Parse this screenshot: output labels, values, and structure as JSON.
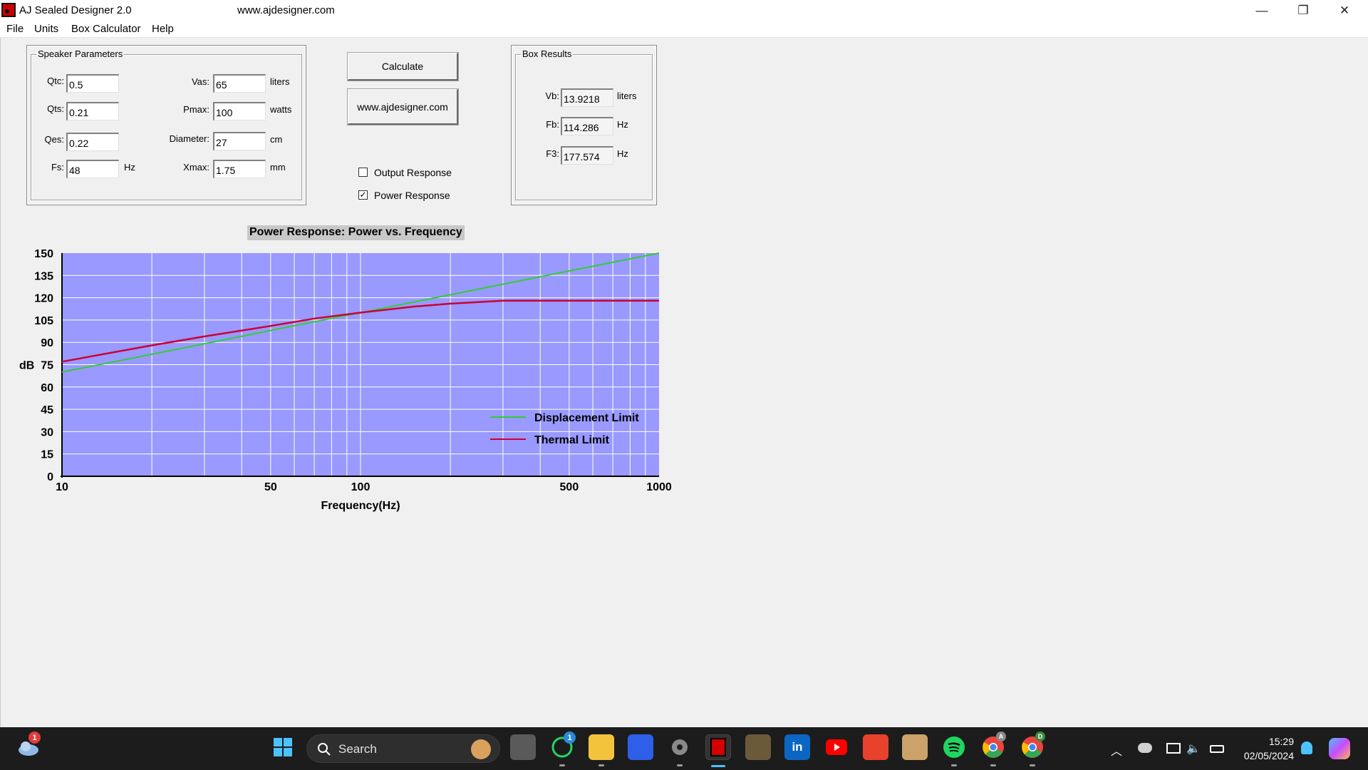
{
  "window": {
    "title": "AJ Sealed Designer 2.0",
    "url": "www.ajdesigner.com",
    "minimize_glyph": "—",
    "restore_glyph": "❐",
    "close_glyph": "✕"
  },
  "menu": [
    "File",
    "Units",
    "Box Calculator",
    "Help"
  ],
  "speaker_params": {
    "legend": "Speaker Parameters",
    "qtc": {
      "label": "Qtc:",
      "value": "0.5"
    },
    "qts": {
      "label": "Qts:",
      "value": "0.21"
    },
    "qes": {
      "label": "Qes:",
      "value": "0.22"
    },
    "fs": {
      "label": "Fs:",
      "value": "48",
      "unit": "Hz"
    },
    "vas": {
      "label": "Vas:",
      "value": "65",
      "unit": "liters"
    },
    "pmax": {
      "label": "Pmax:",
      "value": "100",
      "unit": "watts"
    },
    "diameter": {
      "label": "Diameter:",
      "value": "27",
      "unit": "cm"
    },
    "xmax": {
      "label": "Xmax:",
      "value": "1.75",
      "unit": "mm"
    }
  },
  "buttons": {
    "calculate": "Calculate",
    "website": "www.ajdesigner.com"
  },
  "options": {
    "output_response": {
      "label": "Output Response",
      "checked": false
    },
    "power_response": {
      "label": "Power Response",
      "checked": true
    },
    "check_glyph": "✓"
  },
  "box_results": {
    "legend": "Box Results",
    "vb": {
      "label": "Vb:",
      "value": "13.9218",
      "unit": "liters"
    },
    "fb": {
      "label": "Fb:",
      "value": "114.286",
      "unit": "Hz"
    },
    "f3": {
      "label": "F3:",
      "value": "177.574",
      "unit": "Hz"
    }
  },
  "chart_data": {
    "type": "line",
    "title": "Power Response: Power vs. Frequency",
    "xlabel": "Frequency(Hz)",
    "ylabel": "dB",
    "x_scale": "log",
    "xlim": [
      10,
      1000
    ],
    "ylim": [
      0,
      150
    ],
    "x_ticks": [
      10,
      50,
      100,
      500,
      1000
    ],
    "y_ticks": [
      0,
      15,
      30,
      45,
      60,
      75,
      90,
      105,
      120,
      135,
      150
    ],
    "grid": true,
    "plot_background": "#9999ff",
    "legend_position": "bottom-right",
    "series": [
      {
        "name": "Displacement Limit",
        "color": "#33cc33",
        "points": [
          [
            10,
            70
          ],
          [
            20,
            82
          ],
          [
            50,
            98
          ],
          [
            100,
            110
          ],
          [
            200,
            122
          ],
          [
            500,
            138
          ],
          [
            1000,
            150
          ]
        ]
      },
      {
        "name": "Thermal Limit",
        "color": "#cc0033",
        "points": [
          [
            10,
            77
          ],
          [
            20,
            88
          ],
          [
            30,
            94
          ],
          [
            50,
            101
          ],
          [
            70,
            106
          ],
          [
            100,
            110
          ],
          [
            150,
            114
          ],
          [
            200,
            116
          ],
          [
            300,
            118
          ],
          [
            500,
            118
          ],
          [
            1000,
            118
          ]
        ]
      }
    ]
  },
  "taskbar": {
    "search_label": "Search",
    "icons": [
      "weather-icon",
      "windows-start-icon",
      "task-view-icon",
      "whatsapp-icon",
      "file-explorer-icon",
      "code-editor-icon",
      "settings-icon",
      "aj-designer-icon",
      "crest-icon",
      "linkedin-icon",
      "youtube-icon",
      "mail-icon",
      "reader-icon",
      "spotify-icon",
      "chrome-icon",
      "chrome-profile-icon"
    ],
    "weather_badge": "1",
    "whatsapp_badge": "1",
    "chrome_a_badge": "A",
    "chrome_d_badge": "D",
    "linkedin_glyph": "in",
    "time": "15:29",
    "date": "02/05/2024"
  }
}
